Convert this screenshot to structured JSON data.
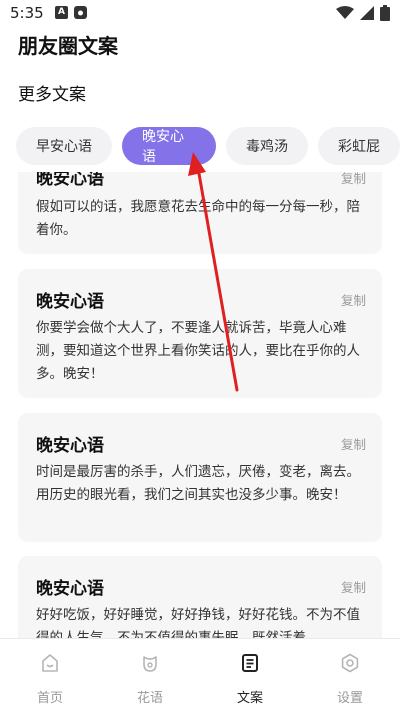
{
  "status": {
    "time": "5:35",
    "notif_icons": [
      "app-a-icon",
      "shield-icon"
    ],
    "right_icons": [
      "wifi-icon",
      "signal-icon",
      "battery-icon"
    ]
  },
  "header": {
    "title": "朋友圈文案",
    "section": "更多文案"
  },
  "tabs": [
    {
      "label": "早安心语",
      "active": false
    },
    {
      "label": "晚安心语",
      "active": true
    },
    {
      "label": "毒鸡汤",
      "active": false
    },
    {
      "label": "彩虹屁",
      "active": false
    }
  ],
  "cards": [
    {
      "title": "晚安心语",
      "copy": "复制",
      "body": "假如可以的话，我愿意花去生命中的每一分每一秒，陪着你。"
    },
    {
      "title": "晚安心语",
      "copy": "复制",
      "body": "你要学会做个大人了，不要逢人就诉苦，毕竟人心难测，要知道这个世界上看你笑话的人，要比在乎你的人多。晚安！"
    },
    {
      "title": "晚安心语",
      "copy": "复制",
      "body": "时间是最厉害的杀手，人们遗忘，厌倦，变老，离去。用历史的眼光看，我们之间其实也没多少事。晚安！"
    },
    {
      "title": "晚安心语",
      "copy": "复制",
      "body": "好好吃饭，好好睡觉，好好挣钱，好好花钱。不为不值得的人生气，不为不值得的事失眠，既然活着"
    }
  ],
  "nav": [
    {
      "label": "首页",
      "icon": "home-icon",
      "active": false
    },
    {
      "label": "花语",
      "icon": "flower-icon",
      "active": false
    },
    {
      "label": "文案",
      "icon": "document-icon",
      "active": true
    },
    {
      "label": "设置",
      "icon": "settings-icon",
      "active": false
    }
  ],
  "colors": {
    "accent": "#8472e8",
    "annotation_arrow": "#e02020",
    "card_bg": "#f6f6f7"
  }
}
